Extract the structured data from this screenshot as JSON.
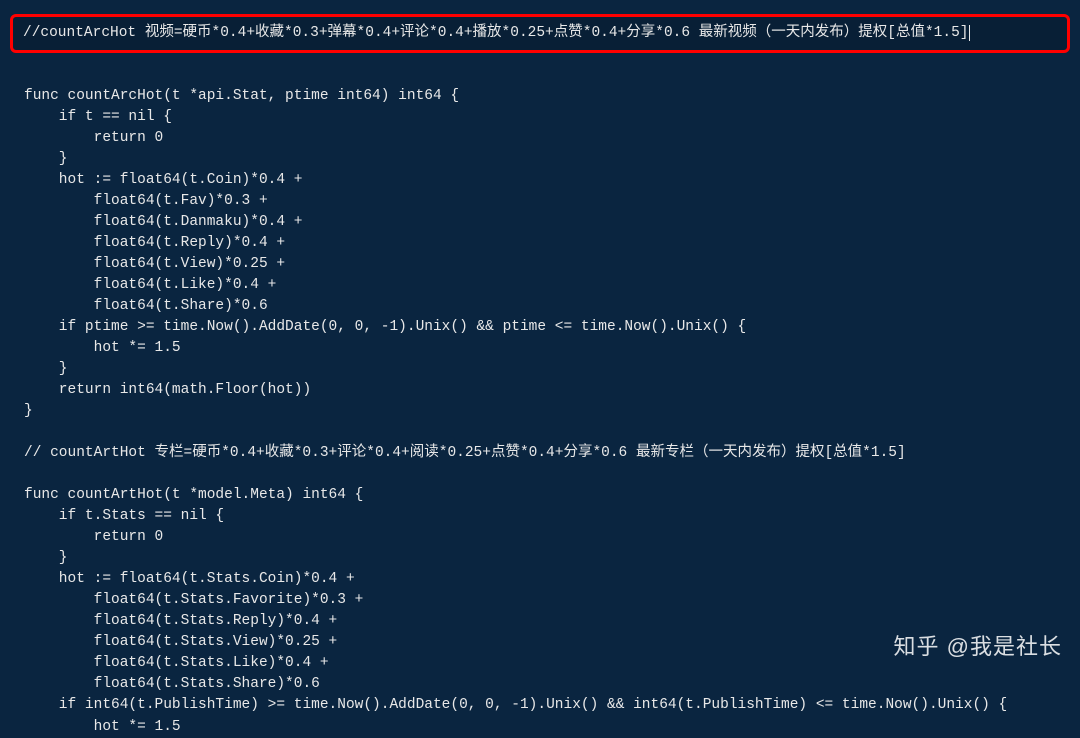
{
  "highlight": {
    "text": "//countArcHot 视频=硬币*0.4+收藏*0.3+弹幕*0.4+评论*0.4+播放*0.25+点赞*0.4+分享*0.6 最新视频（一天内发布）提权[总值*1.5]"
  },
  "code": "\nfunc countArcHot(t *api.Stat, ptime int64) int64 {\n    if t == nil {\n        return 0\n    }\n    hot := float64(t.Coin)*0.4 +\n        float64(t.Fav)*0.3 +\n        float64(t.Danmaku)*0.4 +\n        float64(t.Reply)*0.4 +\n        float64(t.View)*0.25 +\n        float64(t.Like)*0.4 +\n        float64(t.Share)*0.6\n    if ptime >= time.Now().AddDate(0, 0, -1).Unix() && ptime <= time.Now().Unix() {\n        hot *= 1.5\n    }\n    return int64(math.Floor(hot))\n}\n\n// countArtHot 专栏=硬币*0.4+收藏*0.3+评论*0.4+阅读*0.25+点赞*0.4+分享*0.6 最新专栏（一天内发布）提权[总值*1.5]\n\nfunc countArtHot(t *model.Meta) int64 {\n    if t.Stats == nil {\n        return 0\n    }\n    hot := float64(t.Stats.Coin)*0.4 +\n        float64(t.Stats.Favorite)*0.3 +\n        float64(t.Stats.Reply)*0.4 +\n        float64(t.Stats.View)*0.25 +\n        float64(t.Stats.Like)*0.4 +\n        float64(t.Stats.Share)*0.6\n    if int64(t.PublishTime) >= time.Now().AddDate(0, 0, -1).Unix() && int64(t.PublishTime) <= time.Now().Unix() {\n        hot *= 1.5",
  "watermark": "知乎 @我是社长"
}
